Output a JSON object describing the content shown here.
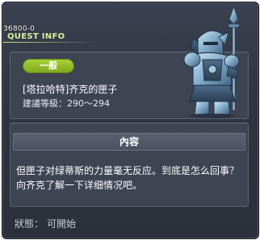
{
  "quest": {
    "id": "36800-0",
    "header_title": "QUEST INFO",
    "badge_label": "一般",
    "name": "[塔拉哈特]齐克的匣子",
    "level_requirement": "建議等級：290～294"
  },
  "content": {
    "header": "內容",
    "description": "但匣子对绿蒂斯的力量毫无反应。到底是怎么回事？向齐克了解一下详细情况吧。"
  },
  "status": {
    "label": "狀態：",
    "value": "可開始"
  },
  "icons": {
    "quest_npc_icon": "armored-knight-icon"
  },
  "colors": {
    "badge": "#8fbb27",
    "title_text": "#d6ef9a",
    "window_bg": "#2f3541"
  }
}
